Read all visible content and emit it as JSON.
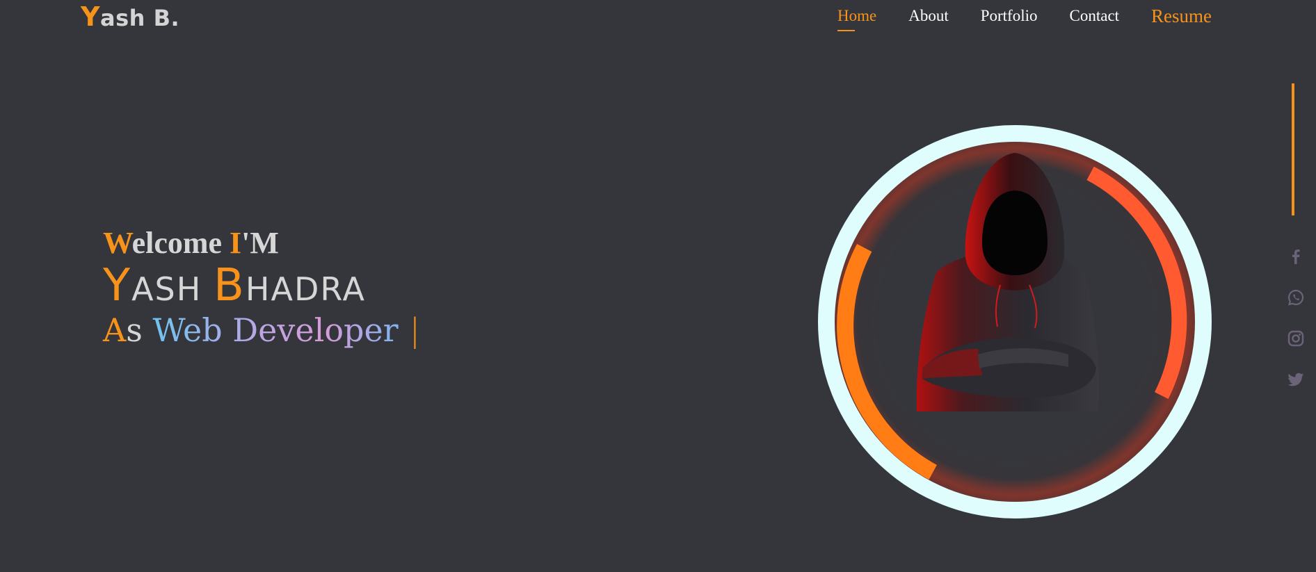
{
  "logo": {
    "first": "Y",
    "rest": "ash B."
  },
  "nav": {
    "items": [
      {
        "label": "Home",
        "active": true
      },
      {
        "label": "About",
        "active": false
      },
      {
        "label": "Portfolio",
        "active": false
      },
      {
        "label": "Contact",
        "active": false
      }
    ],
    "resume": "Resume"
  },
  "hero": {
    "welcome": {
      "w": "W",
      "rest1": "elcome ",
      "i": "I",
      "rest2": "'M"
    },
    "name": {
      "y": "Y",
      "first_rest": "ASH ",
      "b": "B",
      "last_rest": "HADRA"
    },
    "role": {
      "a": "A",
      "s": "s ",
      "title": "Web Developer",
      "cursor": "|"
    }
  },
  "social": [
    "facebook-icon",
    "whatsapp-icon",
    "instagram-icon",
    "twitter-icon"
  ],
  "colors": {
    "background": "#35363b",
    "accent": "#f7931a",
    "ring": "#dffdfd",
    "arc_right": "#ff5a30",
    "social_icon": "#6b6378"
  }
}
